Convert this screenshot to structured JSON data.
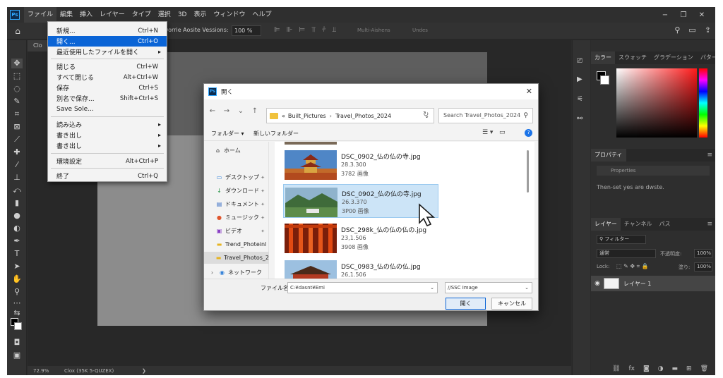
{
  "app": {
    "logo": "Ps",
    "menu": [
      "ファイル",
      "編集",
      "挿入",
      "レイヤー",
      "タイプ",
      "選択",
      "3D",
      "表示",
      "ウィンドウ",
      "ヘルプ"
    ],
    "window_controls": [
      "−",
      "❐",
      "✕"
    ]
  },
  "options_bar": {
    "text": "Dorrie Aosite Vessions:",
    "zoom": "100 %",
    "multi": "Multi-Aishens",
    "undo": "Undes"
  },
  "file_menu": {
    "items": [
      {
        "label": "新規...",
        "shortcut": "Ctrl+N"
      },
      {
        "label": "開く...",
        "shortcut": "Ctrl+O"
      },
      {
        "label": "最近使用したファイルを開く",
        "shortcut": "▸"
      },
      {
        "label": "閉じる",
        "shortcut": "Ctrl+W"
      },
      {
        "label": "すべて閉じる",
        "shortcut": "Alt+Ctrl+W"
      },
      {
        "label": "保存",
        "shortcut": "Ctrl+S"
      },
      {
        "label": "別名で保存...",
        "shortcut": "Shift+Ctrl+S"
      },
      {
        "label": "Save Sole...",
        "shortcut": ""
      },
      {
        "label": "読み込み",
        "shortcut": "▸"
      },
      {
        "label": "書き出し",
        "shortcut": "▸"
      },
      {
        "label": "書き出し",
        "shortcut": "▸"
      },
      {
        "label": "環境設定",
        "shortcut": "Alt+Ctrl+P"
      },
      {
        "label": "終了",
        "shortcut": "Ctrl+Q"
      }
    ]
  },
  "document": {
    "tab": "Clo",
    "status_zoom": "72.9%",
    "status_info": "Clox (35K 5-QUZEX)",
    "status_arrow": "❯"
  },
  "panels": {
    "color_tabs": [
      "カラー",
      "スウォッチ",
      "グラデーション",
      "パター"
    ],
    "properties_tab": "プロパティ",
    "properties_label": "Properties",
    "properties_hint": "Then-set yes are dwste.",
    "layers_tabs": [
      "レイヤー",
      "チャンネル",
      "パス"
    ],
    "filter_label": "フィルター",
    "blend_mode": "通常",
    "opacity_label": "不透明度:",
    "opacity_value": "100%",
    "lock_label": "Lock:",
    "fill_label": "塗り:",
    "fill_value": "100%",
    "layer_name": "レイヤー 1"
  },
  "dialog": {
    "title": "開く",
    "path": [
      "Built_Pictures",
      "Travel_Photos_2024"
    ],
    "search_placeholder": "Search Travel_Photos_2024",
    "organize": "フォルダー ▾",
    "new_folder": "新しいフォルダー",
    "nav": [
      {
        "icon": "⌂",
        "label": "ホーム",
        "pin": ""
      },
      {
        "icon": "▭",
        "label": "デスクトップ",
        "pin": "✦"
      },
      {
        "icon": "↓",
        "label": "ダウンロード",
        "pin": "✦"
      },
      {
        "icon": "▤",
        "label": "ドキュメント",
        "pin": "✦"
      },
      {
        "icon": "●",
        "label": "ミュージック",
        "pin": "✦"
      },
      {
        "icon": "▣",
        "label": "ビデオ",
        "pin": "✦"
      },
      {
        "icon": "▬",
        "label": "Trend_Photeinl",
        "pin": ""
      },
      {
        "icon": "▬",
        "label": "Travel_Photos_2",
        "pin": ""
      },
      {
        "icon": "◉",
        "label": "ネットワーク",
        "pin": ""
      }
    ],
    "files": [
      {
        "name": "DSC_0902_仏の仏の寺.jpg",
        "date": "28.3.300",
        "size": "3782 画像"
      },
      {
        "name": "DSC_0902_仏の仏の寺.jpg",
        "date": "26.3.370",
        "size": "3P00 画像"
      },
      {
        "name": "DSC_298k_仏の仏の仏の.jpg",
        "date": "23,1.506",
        "size": "3908 画像"
      },
      {
        "name": "DSC_0983_仏の仏の仏.jpg",
        "date": "26,1.506",
        "size": ""
      }
    ],
    "filename_label": "ファイル名:",
    "filename_value": "C:¥dasnt¥Emi",
    "filetype_value": "//SSC Image",
    "open_button": "開く",
    "cancel_button": "キャンセル"
  },
  "colors": {
    "accent": "#0a64d6",
    "selection": "#cce4f7",
    "ps_blue": "#31a8ff"
  }
}
